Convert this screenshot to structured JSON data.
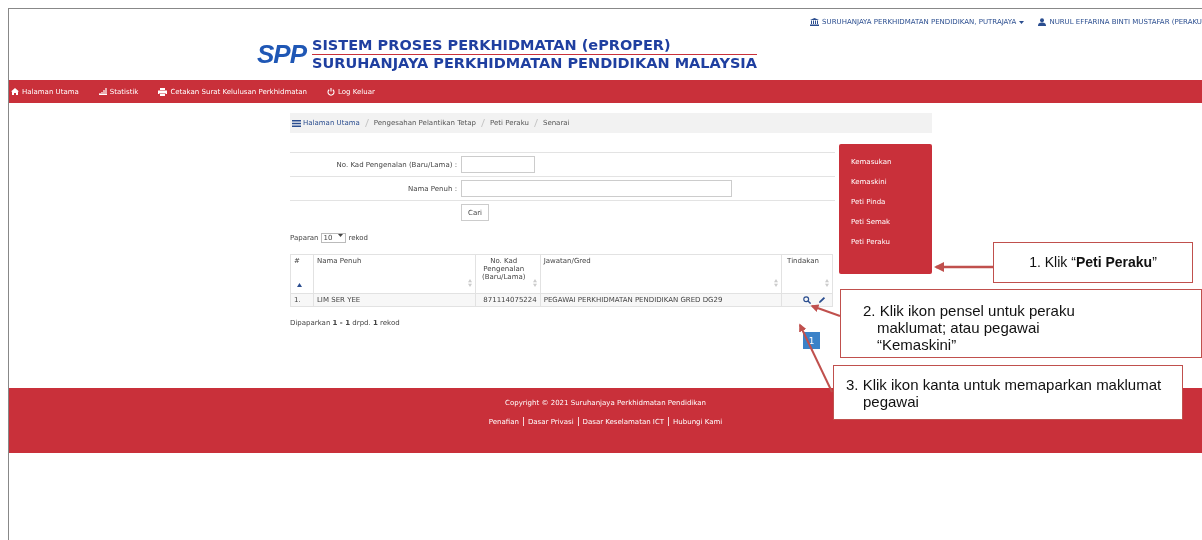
{
  "top_links": [
    {
      "kind": "institution",
      "label": "SURUHANJAYA PERKHIDMATAN PENDIDIKAN, PUTRAJAYA",
      "dropdown": true
    },
    {
      "kind": "user",
      "label": "NURUL EFFARINA BINTI MUSTAFAR (PERAKU",
      "dropdown": false
    }
  ],
  "logo": {
    "mark": "SPP",
    "title": "SISTEM PROSES PERKHIDMATAN (ePROPER)",
    "subtitle": "SURUHANJAYA PERKHIDMATAN PENDIDIKAN MALAYSIA"
  },
  "nav": [
    {
      "kind": "home",
      "label": "Halaman Utama"
    },
    {
      "kind": "chart",
      "label": "Statistik"
    },
    {
      "kind": "print",
      "label": "Cetakan Surat Kelulusan Perkhidmatan"
    },
    {
      "kind": "power",
      "label": "Log Keluar"
    }
  ],
  "breadcrumb": [
    "Halaman Utama",
    "Pengesahan Pelantikan Tetap",
    "Peti Peraku",
    "Senarai"
  ],
  "form": {
    "fields": [
      {
        "label": "No. Kad Pengenalan (Baru/Lama) :"
      },
      {
        "label": "Nama Penuh :"
      }
    ],
    "button": "Cari"
  },
  "page_size": {
    "before": "Paparan",
    "value": "10",
    "after": "rekod"
  },
  "table": {
    "columns": [
      {
        "label": "#",
        "sorted": true
      },
      {
        "label": "Nama Penuh",
        "sorted": false
      },
      {
        "label": "No. Kad Pengenalan (Baru/Lama)",
        "sorted": false
      },
      {
        "label": "Jawatan/Gred",
        "sorted": false
      },
      {
        "label": "Tindakan",
        "sorted": false
      }
    ],
    "rows": [
      {
        "no": "1.",
        "name": "LIM SER YEE",
        "ic": "871114075224",
        "post": "PEGAWAI PERKHIDMATAN PENDIDIKAN GRED DG29"
      }
    ]
  },
  "summary": "Dipaparkan **1 - 1** drpd. **1** rekod",
  "pagination": [
    "1"
  ],
  "side_menu": [
    "Kemasukan",
    "Kemaskini",
    "Peti Pinda",
    "Peti Semak",
    "Peti Peraku"
  ],
  "footer": {
    "copyright": "Copyright © 2021 Suruhanjaya Perkhidmatan Pendidikan",
    "links": [
      "Penafian",
      "Dasar Privasi",
      "Dasar Keselamatan ICT",
      "Hubungi Kami"
    ]
  },
  "callouts": [
    {
      "text": "1. Klik “**Peti Peraku**”"
    },
    {
      "text": "2. Klik ikon pensel untuk peraku maklumat; atau pegawai “Kemaskini”"
    },
    {
      "text": "3. Klik ikon kanta untuk memaparkan maklumat pegawai"
    }
  ]
}
